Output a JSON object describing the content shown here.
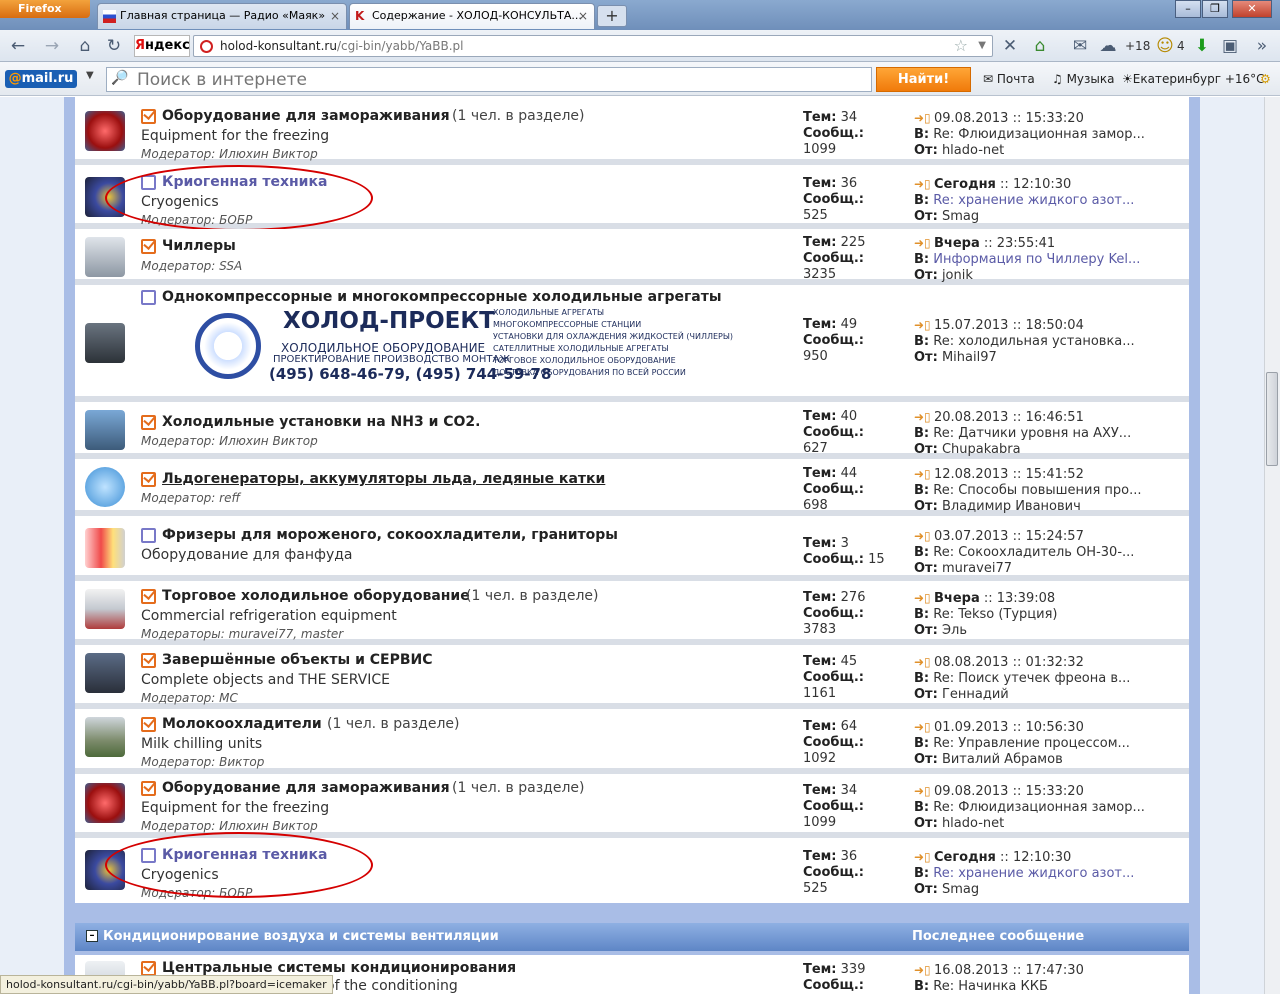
{
  "browser": {
    "menu_button": "Firefox",
    "tabs": [
      {
        "title": "Главная страница — Радио «Маяк»"
      },
      {
        "title": "Содержание - ХОЛОД-КОНСУЛЬТА..."
      }
    ],
    "new_tab": "+",
    "yandex": "Яндекс",
    "url_host": "holod-konsultant.ru",
    "url_path": "/cgi-bin/yabb/YaBB.pl",
    "weather_extra": "+18",
    "notif_count": "4"
  },
  "mailru": {
    "logo": "mail.ru",
    "search_placeholder": "Поиск в интернете",
    "search_button": "Найти!",
    "mail": "Почта",
    "music": "Музыка",
    "weather": "Екатеринбург +16°C"
  },
  "boards": [
    {
      "title": "Оборудование для замораживания",
      "members": "(1 чел. в разделе)",
      "desc": "Equipment for the freezing",
      "mod": "Модератор: Илюхин Виктор",
      "topics": "34",
      "posts": "1099",
      "date_bold": "",
      "date": "09.08.2013 :: 15:33:20",
      "in": "Re: Флюидизационная замор...",
      "from": "hlado-net",
      "in_link": false
    },
    {
      "title": "Криогенная техника",
      "members": "",
      "desc": "Cryogenics",
      "mod": "Модератор: БОБР",
      "topics": "36",
      "posts": "525",
      "date_bold": "Сегодня",
      "date": " :: 12:10:30",
      "in": "Re: хранение жидкого азот...",
      "from": "Smag",
      "in_link": true
    },
    {
      "title": "Чиллеры",
      "members": "",
      "desc": "",
      "mod": "Модератор: SSA",
      "topics": "225",
      "posts": "3235",
      "date_bold": "Вчера",
      "date": " :: 23:55:41",
      "in": "Информация по Чиллеру Kel...",
      "from": "jonik",
      "in_link": true
    },
    {
      "title": "Однокомпрессорные и многокомпрессорные холодильные агрегаты",
      "members": "",
      "desc": "",
      "mod": "",
      "topics": "49",
      "posts": "950",
      "date_bold": "",
      "date": "15.07.2013 :: 18:50:04",
      "in": "Re: холодильная установка...",
      "from": "Mihail97",
      "in_link": false
    },
    {
      "title": "Холодильные установки на NH3  и CO2.",
      "members": "",
      "desc": "",
      "mod": "Модератор: Илюхин Виктор",
      "topics": "40",
      "posts": "627",
      "date_bold": "",
      "date": "20.08.2013 :: 16:46:51",
      "in": "Re: Датчики уровня на АХУ...",
      "from": "Chupakabra",
      "in_link": false
    },
    {
      "title": "Льдогенераторы, аккумуляторы льда, ледяные катки",
      "members": "",
      "desc": "",
      "mod": "Модератор: reff",
      "topics": "44",
      "posts": "698",
      "date_bold": "",
      "date": "12.08.2013 :: 15:41:52",
      "in": "Re: Способы повышения про...",
      "from": "Владимир Иванович",
      "in_link": false
    },
    {
      "title": "Фризеры для мороженого, сокоохладители, граниторы",
      "members": "",
      "desc": "Оборудование для фанфуда",
      "mod": "",
      "topics": "3",
      "posts": "15",
      "date_bold": "",
      "date": "03.07.2013 :: 15:24:57",
      "in": "Re: Сокоохладитель ОН-30-...",
      "from": "muravei77",
      "in_link": false
    },
    {
      "title": "Торговое холодильное оборудование",
      "members": "(1 чел. в разделе)",
      "desc": "Commercial refrigeration equipment",
      "mod": "Модераторы: muravei77, master",
      "topics": "276",
      "posts": "3783",
      "date_bold": "Вчера",
      "date": " :: 13:39:08",
      "in": "Re: Tekso (Турция)",
      "from": "Эль",
      "in_link": false
    },
    {
      "title": "Завершённые объекты и СЕРВИС",
      "members": "",
      "desc": "Complete objects and THE SERVICE",
      "mod": "Модератор: MC",
      "topics": "45",
      "posts": "1161",
      "date_bold": "",
      "date": "08.08.2013 :: 01:32:32",
      "in": "Re: Поиск утечек фреона в...",
      "from": "Геннадий",
      "in_link": false
    },
    {
      "title": "Молокоохладители",
      "members": "(1 чел. в разделе)",
      "desc": "Milk chilling units",
      "mod": "Модератор: Виктор",
      "topics": "64",
      "posts": "1092",
      "date_bold": "",
      "date": "01.09.2013 :: 10:56:30",
      "in": "Re: Управление процессом...",
      "from": "Виталий Абрамов",
      "in_link": false
    },
    {
      "title": "Оборудование для замораживания",
      "members": "(1 чел. в разделе)",
      "desc": "Equipment for the freezing",
      "mod": "Модератор: Илюхин Виктор",
      "topics": "34",
      "posts": "1099",
      "date_bold": "",
      "date": "09.08.2013 :: 15:33:20",
      "in": "Re: Флюидизационная замор...",
      "from": "hlado-net",
      "in_link": false
    },
    {
      "title": "Криогенная техника",
      "members": "",
      "desc": "Cryogenics",
      "mod": "Модератор: БОБР",
      "topics": "36",
      "posts": "525",
      "date_bold": "Сегодня",
      "date": " :: 12:10:30",
      "in": "Re: хранение жидкого азот...",
      "from": "Smag",
      "in_link": true
    }
  ],
  "labels": {
    "topics": "Тем:",
    "posts": "Сообщ.:",
    "in": "В:",
    "from": "От:"
  },
  "ad": {
    "title": "ХОЛОД-ПРОЕКТ",
    "sub1": "ХОЛОДИЛЬНОЕ ОБОРУДОВАНИЕ",
    "sub2": "ПРОЕКТИРОВАНИЕ ПРОИЗВОДСТВО МОНТАЖ",
    "phone": "(495) 648-46-79, (495) 744-59-78",
    "list": [
      "Холодильные агрегаты",
      "Многокомпрессорные станции",
      "Установки для охлаждения жидкостей (чиллеры)",
      "Сателлитные холодильные агрегаты",
      "Торговое холодильное оборудование",
      "Доставка оборудования по всей России"
    ]
  },
  "section": {
    "title": "Кондиционирование воздуха и системы вентиляции",
    "last_post": "Последнее сообщение",
    "next_title": "Центральные системы кондиционирования",
    "next_desc": "of the conditioning",
    "next_topics": "339",
    "next_date": "16.08.2013 :: 17:47:30",
    "next_in": "Re: Начинка ККБ"
  },
  "status_url": "holod-konsultant.ru/cgi-bin/yabb/YaBB.pl?board=icemaker"
}
